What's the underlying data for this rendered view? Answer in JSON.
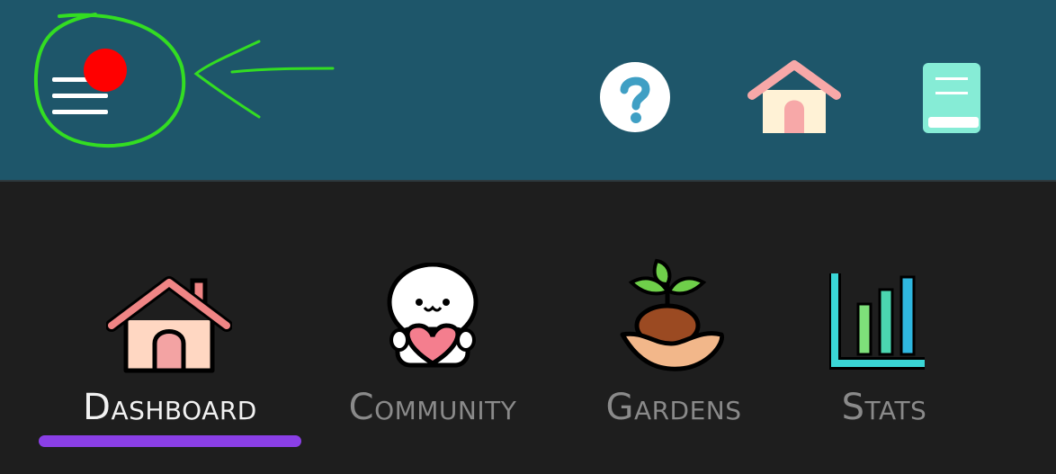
{
  "header": {
    "menu_icon": "hamburger-menu-icon",
    "notification_dot_color": "#ff0000",
    "annotation_color": "#33dd22",
    "actions": [
      {
        "name": "help",
        "icon": "question-mark-icon"
      },
      {
        "name": "home",
        "icon": "house-icon"
      },
      {
        "name": "guide",
        "icon": "book-icon"
      }
    ],
    "background": "#1e566a"
  },
  "nav": {
    "active_tab": "dashboard",
    "indicator_color": "#8a3fe6",
    "tabs": [
      {
        "id": "dashboard",
        "label": "Dashboard",
        "icon": "house-icon"
      },
      {
        "id": "community",
        "label": "Community",
        "icon": "heart-mascot-icon"
      },
      {
        "id": "gardens",
        "label": "Gardens",
        "icon": "sprout-in-hand-icon"
      },
      {
        "id": "stats",
        "label": "Stats",
        "icon": "bar-chart-icon"
      }
    ]
  }
}
